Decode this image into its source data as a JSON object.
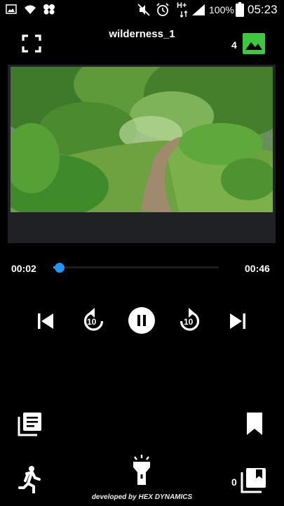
{
  "status_bar": {
    "battery_percent": "100%",
    "time": "05:23",
    "network_type": "H+",
    "icons": [
      "image-icon",
      "wifi-icon",
      "cluster-icon",
      "mute-icon",
      "alarm-icon",
      "network-icon",
      "signal-icon",
      "battery-icon"
    ]
  },
  "header": {
    "title": "wilderness_1",
    "image_count": "4",
    "left_icon": "fullscreen-icon",
    "right_icon": "gallery-icon",
    "accent": "#3ec83e"
  },
  "player": {
    "current_time": "00:02",
    "duration": "00:46",
    "progress_fraction": 0.04,
    "seek_color": "#2196f3",
    "skip_seconds": "10",
    "state": "playing"
  },
  "bottom": {
    "queue_count": "0",
    "developer_credit": "developed by HEX DYNAMICS"
  }
}
